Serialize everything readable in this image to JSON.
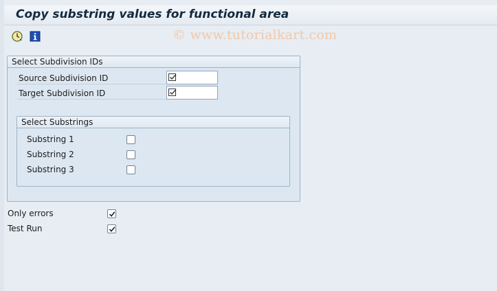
{
  "title": "Copy substring values for functional area",
  "watermark": "© www.tutorialkart.com",
  "toolbar": {
    "execute_icon": "execute-clock-icon",
    "info_icon": "info-icon"
  },
  "subdivision_group": {
    "title": "Select Subdivision IDs",
    "source_label": "Source Subdivision ID",
    "target_label": "Target Subdivision ID",
    "source_value": "",
    "target_value": ""
  },
  "substrings_group": {
    "title": "Select Substrings",
    "items": [
      {
        "label": "Substring 1",
        "checked": false
      },
      {
        "label": "Substring 2",
        "checked": false
      },
      {
        "label": "Substring 3",
        "checked": false
      }
    ]
  },
  "options": {
    "only_errors_label": "Only errors",
    "only_errors_checked": true,
    "test_run_label": "Test Run",
    "test_run_checked": true
  },
  "colors": {
    "background": "#e7edf3",
    "group_bg": "#dce7f1",
    "group_border": "#9eb2c6",
    "title_color": "#132a40",
    "watermark": "#f2c8a9"
  }
}
